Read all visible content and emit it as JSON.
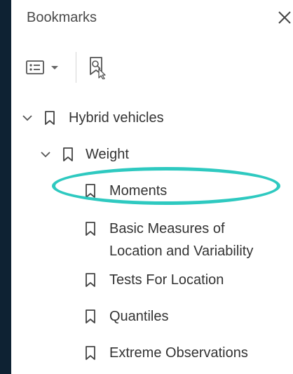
{
  "panel": {
    "title": "Bookmarks"
  },
  "toolbar": {
    "options_icon": "list-options-icon",
    "dropdown_icon": "caret-down-icon",
    "find_icon": "find-bookmark-icon",
    "close_icon": "close-icon"
  },
  "bookmarks": [
    {
      "label": "Hybrid vehicles",
      "level": 0,
      "expanded": true
    },
    {
      "label": "Weight",
      "level": 1,
      "expanded": true
    },
    {
      "label": "Moments",
      "level": 2,
      "highlighted": true
    },
    {
      "label": "Basic Measures of",
      "label2": "Location and Variability",
      "level": 2
    },
    {
      "label": "Tests For Location",
      "level": 2
    },
    {
      "label": "Quantiles",
      "level": 2
    },
    {
      "label": "Extreme Observations",
      "level": 2
    }
  ],
  "colors": {
    "background": "#0e2233",
    "panel": "#ffffff",
    "highlight": "#2ec9c0",
    "text": "#333333"
  }
}
